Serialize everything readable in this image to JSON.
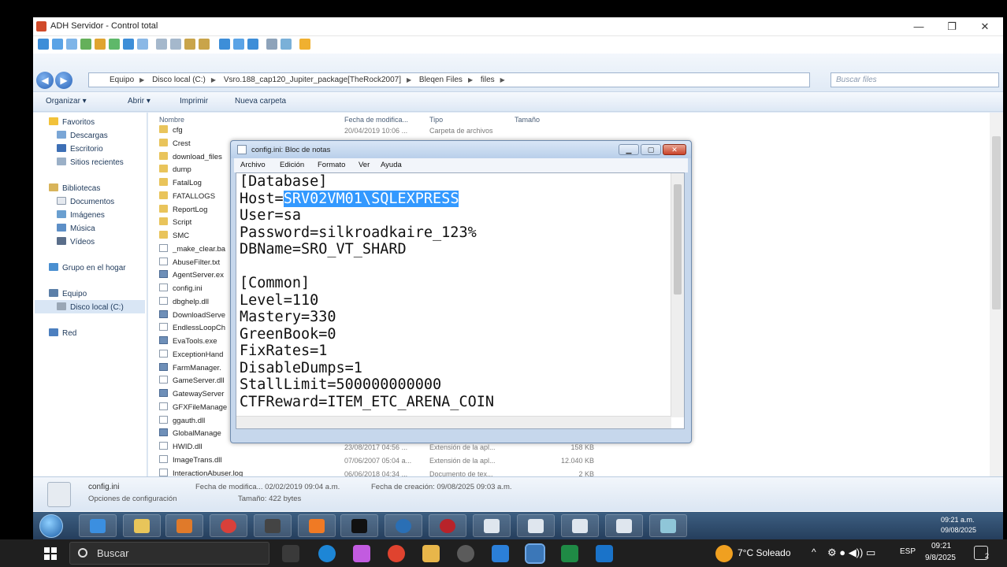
{
  "rdp_window": {
    "title": "ADH Servidor - Control total",
    "controls": [
      "—",
      "❐",
      "✕"
    ]
  },
  "explorer": {
    "breadcrumbs": [
      "Equipo",
      "Disco local (C:)",
      "Vsro.188_cap120_Jupiter_package[TheRock2007]",
      "Bleqen Files",
      "files"
    ],
    "search_placeholder": "Buscar files",
    "commands": [
      "Organizar ▾",
      "Abrir ▾",
      "Imprimir",
      "Nueva carpeta"
    ],
    "nav": {
      "favorites": "Favoritos",
      "downloads": "Descargas",
      "desktop": "Escritorio",
      "recent": "Sitios recientes",
      "libraries": "Bibliotecas",
      "documents": "Documentos",
      "images": "Imágenes",
      "music": "Música",
      "videos": "Vídeos",
      "homegroup": "Grupo en el hogar",
      "computer": "Equipo",
      "local_disk": "Disco local (C:)",
      "network": "Red"
    },
    "columns": {
      "name": "Nombre",
      "modified": "Fecha de modifica...",
      "type": "Tipo",
      "size": "Tamaño"
    },
    "files": [
      {
        "name": "cfg",
        "kind": "folder",
        "date": "20/04/2019 10:06 ...",
        "type": "Carpeta de archivos",
        "size": ""
      },
      {
        "name": "Crest",
        "kind": "folder",
        "date": "",
        "type": "",
        "size": ""
      },
      {
        "name": "download_files",
        "kind": "folder",
        "date": "",
        "type": "",
        "size": ""
      },
      {
        "name": "dump",
        "kind": "folder",
        "date": "",
        "type": "",
        "size": ""
      },
      {
        "name": "FatalLog",
        "kind": "folder",
        "date": "",
        "type": "",
        "size": ""
      },
      {
        "name": "FATALLOGS",
        "kind": "folder",
        "date": "",
        "type": "",
        "size": ""
      },
      {
        "name": "ReportLog",
        "kind": "folder",
        "date": "",
        "type": "",
        "size": ""
      },
      {
        "name": "Script",
        "kind": "folder",
        "date": "",
        "type": "",
        "size": ""
      },
      {
        "name": "SMC",
        "kind": "folder",
        "date": "",
        "type": "",
        "size": ""
      },
      {
        "name": "_make_clear.ba",
        "kind": "file",
        "date": "",
        "type": "",
        "size": ""
      },
      {
        "name": "AbuseFilter.txt",
        "kind": "file",
        "date": "",
        "type": "",
        "size": ""
      },
      {
        "name": "AgentServer.ex",
        "kind": "exe",
        "date": "",
        "type": "",
        "size": ""
      },
      {
        "name": "config.ini",
        "kind": "file",
        "date": "",
        "type": "",
        "size": ""
      },
      {
        "name": "dbghelp.dll",
        "kind": "file",
        "date": "",
        "type": "",
        "size": ""
      },
      {
        "name": "DownloadServe",
        "kind": "exe",
        "date": "",
        "type": "",
        "size": ""
      },
      {
        "name": "EndlessLoopCh",
        "kind": "file",
        "date": "",
        "type": "",
        "size": ""
      },
      {
        "name": "EvaTools.exe",
        "kind": "exe",
        "date": "",
        "type": "",
        "size": ""
      },
      {
        "name": "ExceptionHand",
        "kind": "file",
        "date": "",
        "type": "",
        "size": ""
      },
      {
        "name": "FarmManager.",
        "kind": "exe",
        "date": "",
        "type": "",
        "size": ""
      },
      {
        "name": "GameServer.dll",
        "kind": "file",
        "date": "",
        "type": "",
        "size": ""
      },
      {
        "name": "GatewayServer",
        "kind": "exe",
        "date": "",
        "type": "",
        "size": ""
      },
      {
        "name": "GFXFileManage",
        "kind": "file",
        "date": "",
        "type": "",
        "size": ""
      },
      {
        "name": "ggauth.dll",
        "kind": "file",
        "date": "",
        "type": "",
        "size": ""
      },
      {
        "name": "GlobalManage",
        "kind": "exe",
        "date": "",
        "type": "",
        "size": ""
      },
      {
        "name": "HWID.dll",
        "kind": "file",
        "date": "23/08/2017 04:56 ...",
        "type": "Extensión de la apl...",
        "size": "158 KB"
      },
      {
        "name": "ImageTrans.dll",
        "kind": "file",
        "date": "07/06/2007 05:04 a...",
        "type": "Extensión de la apl...",
        "size": "12.040 KB"
      },
      {
        "name": "InteractionAbuser.log",
        "kind": "file",
        "date": "06/06/2018 04:34 ...",
        "type": "Documento de tex...",
        "size": "2 KB"
      }
    ],
    "details": {
      "name": "config.ini",
      "kind": "Opciones de configuración",
      "modified": "Fecha de modifica... 02/02/2019 09:04 a.m.",
      "created": "Fecha de creación: 09/08/2025 09:03 a.m.",
      "size": "Tamaño: 422 bytes"
    }
  },
  "notepad": {
    "title": "config.ini: Bloc de notas",
    "menu": [
      "Archivo",
      "Edición",
      "Formato",
      "Ver",
      "Ayuda"
    ],
    "lines": [
      {
        "pre": "[Database]",
        "sel": "",
        "post": ""
      },
      {
        "pre": "Host=",
        "sel": "SRV02VM01\\SQLEXPRESS",
        "post": ""
      },
      {
        "pre": "User=sa",
        "sel": "",
        "post": ""
      },
      {
        "pre": "Password=silkroadkaire_123%",
        "sel": "",
        "post": ""
      },
      {
        "pre": "DBName=SRO_VT_SHARD",
        "sel": "",
        "post": ""
      },
      {
        "pre": "",
        "sel": "",
        "post": ""
      },
      {
        "pre": "[Common]",
        "sel": "",
        "post": ""
      },
      {
        "pre": "Level=110",
        "sel": "",
        "post": ""
      },
      {
        "pre": "Mastery=330",
        "sel": "",
        "post": ""
      },
      {
        "pre": "GreenBook=0",
        "sel": "",
        "post": ""
      },
      {
        "pre": "FixRates=1",
        "sel": "",
        "post": ""
      },
      {
        "pre": "DisableDumps=1",
        "sel": "",
        "post": ""
      },
      {
        "pre": "StallLimit=500000000000",
        "sel": "",
        "post": ""
      },
      {
        "pre": "CTFReward=ITEM_ETC_ARENA_COIN",
        "sel": "",
        "post": ""
      }
    ]
  },
  "rdp_taskbar": {
    "clock_time": "09:21 a.m.",
    "clock_date": "09/08/2025"
  },
  "host_taskbar": {
    "search": "Buscar",
    "weather": "7°C Soleado",
    "lang": "ESP",
    "time": "09:21",
    "date": "9/8/2025",
    "notifications": "2"
  },
  "colors": {
    "selection": "#3399ff",
    "host_taskbar": "#1f1f1f",
    "rdp_taskbar": "#2f4d6e"
  }
}
